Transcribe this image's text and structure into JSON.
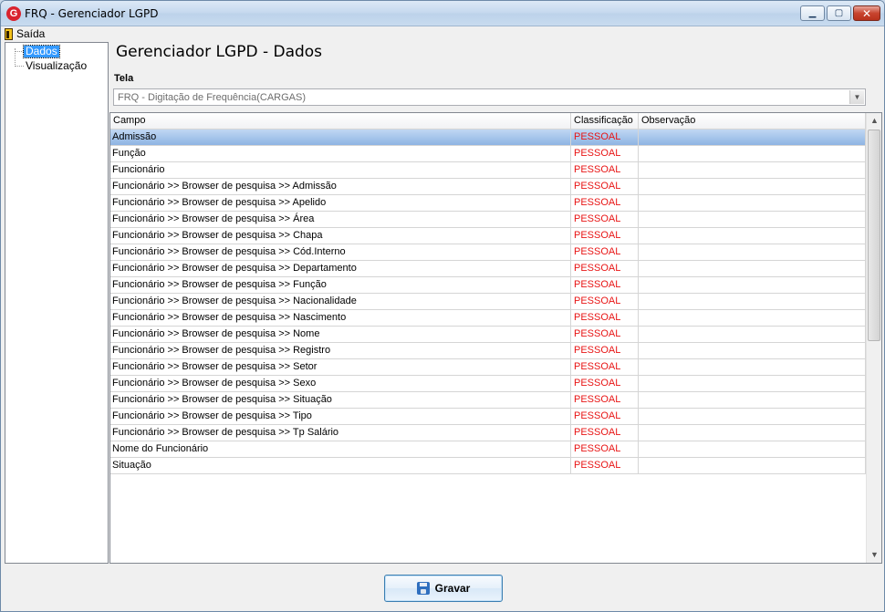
{
  "window": {
    "title": "FRQ - Gerenciador LGPD",
    "app_icon_letter": "G",
    "minimize_glyph": "▁",
    "maximize_glyph": "▢",
    "close_glyph": "✕"
  },
  "menubar": {
    "exit_label": "Saída"
  },
  "tree": {
    "items": [
      {
        "label": "Dados",
        "selected": true
      },
      {
        "label": "Visualização",
        "selected": false
      }
    ]
  },
  "main": {
    "title": "Gerenciador LGPD - Dados",
    "tela_label": "Tela",
    "tela_value": "FRQ - Digitação de Frequência(CARGAS)"
  },
  "grid": {
    "columns": [
      "Campo",
      "Classificação",
      "Observação"
    ],
    "rows": [
      {
        "campo": "Admissão",
        "classificacao": "PESSOAL",
        "observacao": ""
      },
      {
        "campo": "Função",
        "classificacao": "PESSOAL",
        "observacao": ""
      },
      {
        "campo": "Funcionário",
        "classificacao": "PESSOAL",
        "observacao": ""
      },
      {
        "campo": "Funcionário >> Browser de pesquisa >> Admissão",
        "classificacao": "PESSOAL",
        "observacao": ""
      },
      {
        "campo": "Funcionário >> Browser de pesquisa >> Apelido",
        "classificacao": "PESSOAL",
        "observacao": ""
      },
      {
        "campo": "Funcionário >> Browser de pesquisa >> Área",
        "classificacao": "PESSOAL",
        "observacao": ""
      },
      {
        "campo": "Funcionário >> Browser de pesquisa >> Chapa",
        "classificacao": "PESSOAL",
        "observacao": ""
      },
      {
        "campo": "Funcionário >> Browser de pesquisa >> Cód.Interno",
        "classificacao": "PESSOAL",
        "observacao": ""
      },
      {
        "campo": "Funcionário >> Browser de pesquisa >> Departamento",
        "classificacao": "PESSOAL",
        "observacao": ""
      },
      {
        "campo": "Funcionário >> Browser de pesquisa >> Função",
        "classificacao": "PESSOAL",
        "observacao": ""
      },
      {
        "campo": "Funcionário >> Browser de pesquisa >> Nacionalidade",
        "classificacao": "PESSOAL",
        "observacao": ""
      },
      {
        "campo": "Funcionário >> Browser de pesquisa >> Nascimento",
        "classificacao": "PESSOAL",
        "observacao": ""
      },
      {
        "campo": "Funcionário >> Browser de pesquisa >> Nome",
        "classificacao": "PESSOAL",
        "observacao": ""
      },
      {
        "campo": "Funcionário >> Browser de pesquisa >> Registro",
        "classificacao": "PESSOAL",
        "observacao": ""
      },
      {
        "campo": "Funcionário >> Browser de pesquisa >> Setor",
        "classificacao": "PESSOAL",
        "observacao": ""
      },
      {
        "campo": "Funcionário >> Browser de pesquisa >> Sexo",
        "classificacao": "PESSOAL",
        "observacao": ""
      },
      {
        "campo": "Funcionário >> Browser de pesquisa >> Situação",
        "classificacao": "PESSOAL",
        "observacao": ""
      },
      {
        "campo": "Funcionário >> Browser de pesquisa >> Tipo",
        "classificacao": "PESSOAL",
        "observacao": ""
      },
      {
        "campo": "Funcionário >> Browser de pesquisa >> Tp Salário",
        "classificacao": "PESSOAL",
        "observacao": ""
      },
      {
        "campo": "Nome do Funcionário",
        "classificacao": "PESSOAL",
        "observacao": ""
      },
      {
        "campo": "Situação",
        "classificacao": "PESSOAL",
        "observacao": ""
      }
    ],
    "selected_row": 0
  },
  "footer": {
    "save_label": "Gravar",
    "save_icon": "floppy-disk-icon"
  },
  "colors": {
    "classification_text": "#e81515",
    "selection": "#8eb4e3",
    "tree_selection": "#3399ff"
  }
}
